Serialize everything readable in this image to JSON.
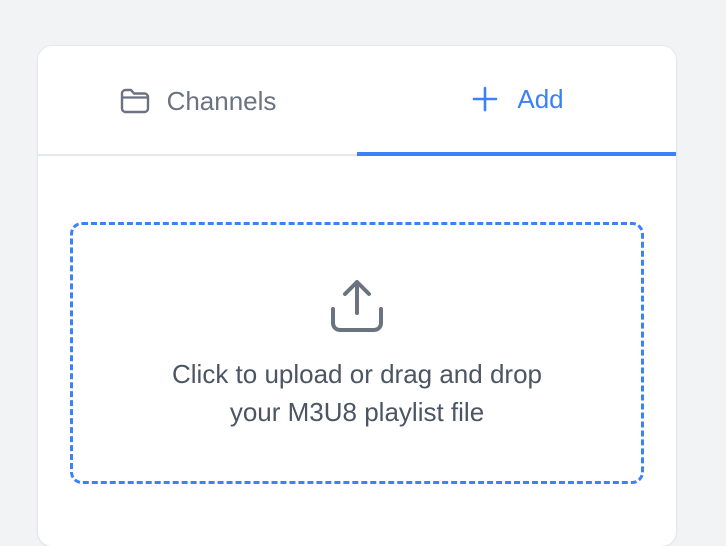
{
  "tabs": [
    {
      "label": "Channels",
      "icon": "folder-icon",
      "active": false
    },
    {
      "label": "Add",
      "icon": "plus-icon",
      "active": true
    }
  ],
  "upload": {
    "line1": "Click to upload or drag and drop",
    "line2": "your M3U8 playlist file",
    "icon": "upload-icon"
  },
  "colors": {
    "accent": "#3b82f6",
    "muted_text": "#6b7280",
    "body_text": "#4b5563",
    "background": "#f2f3f5",
    "card": "#ffffff"
  }
}
